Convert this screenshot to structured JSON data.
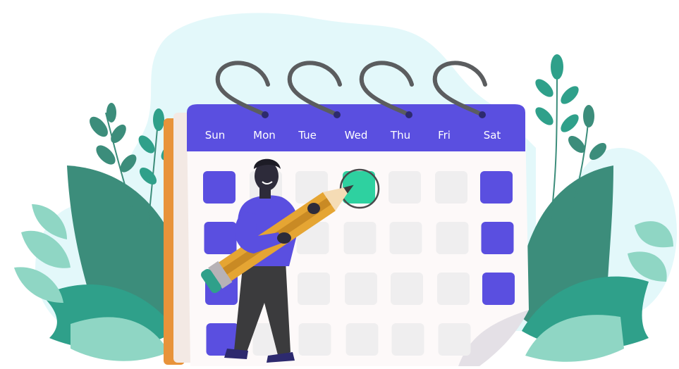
{
  "calendar": {
    "weekdays": [
      "Sun",
      "Mon",
      "Tue",
      "Wed",
      "Thu",
      "Fri",
      "Sat"
    ],
    "colors": {
      "header": "#5a4fe0",
      "weekend_cell": "#5a4fe0",
      "highlight_cell": "#2ed1a0",
      "cell": "#efeeef",
      "page": "#fdf9f9",
      "back_board": "#e8933a",
      "ring": "#5b5d5f"
    }
  },
  "illustration": {
    "icons": [
      "calendar-icon",
      "pencil-icon",
      "person-icon",
      "leaf-icon"
    ],
    "colors": {
      "blob": "#e3f8fa",
      "leaf_dark": "#3c8d7b",
      "leaf_mid": "#2fa08a",
      "leaf_light": "#8fd6c4",
      "shirt": "#5a4fe0",
      "pants": "#3b3b3d",
      "pencil": "#e5a533"
    }
  }
}
